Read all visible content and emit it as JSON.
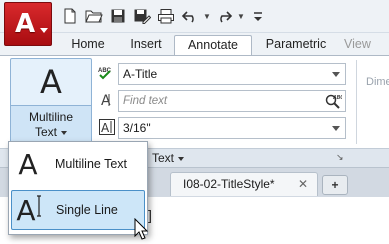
{
  "app": {
    "logo_letter": "A"
  },
  "qat": {
    "icons": [
      "new-icon",
      "open-icon",
      "save-icon",
      "save-as-icon",
      "plot-icon",
      "undo-icon",
      "redo-icon",
      "customize-icon"
    ]
  },
  "tabs": [
    {
      "label": "Home"
    },
    {
      "label": "Insert"
    },
    {
      "label": "Annotate"
    },
    {
      "label": "Parametric"
    },
    {
      "label": "View"
    }
  ],
  "ribbon": {
    "multiline": {
      "glyph": "A",
      "label_line1": "Multiline",
      "label_line2": "Text"
    },
    "text_style": "A-Title",
    "find_placeholder": "Find text",
    "text_height": "3/16\"",
    "panel_title": "Text",
    "launcher": "↘",
    "dim_label": "Dime"
  },
  "menu": {
    "items": [
      {
        "glyph": "A",
        "label": "Multiline Text"
      },
      {
        "glyph": "A",
        "label": "Single Line"
      }
    ]
  },
  "doc_tab": {
    "title": "I08-02-TitleStyle*",
    "close": "✕",
    "new": "+"
  },
  "canvas": {
    "bracket": "]"
  }
}
